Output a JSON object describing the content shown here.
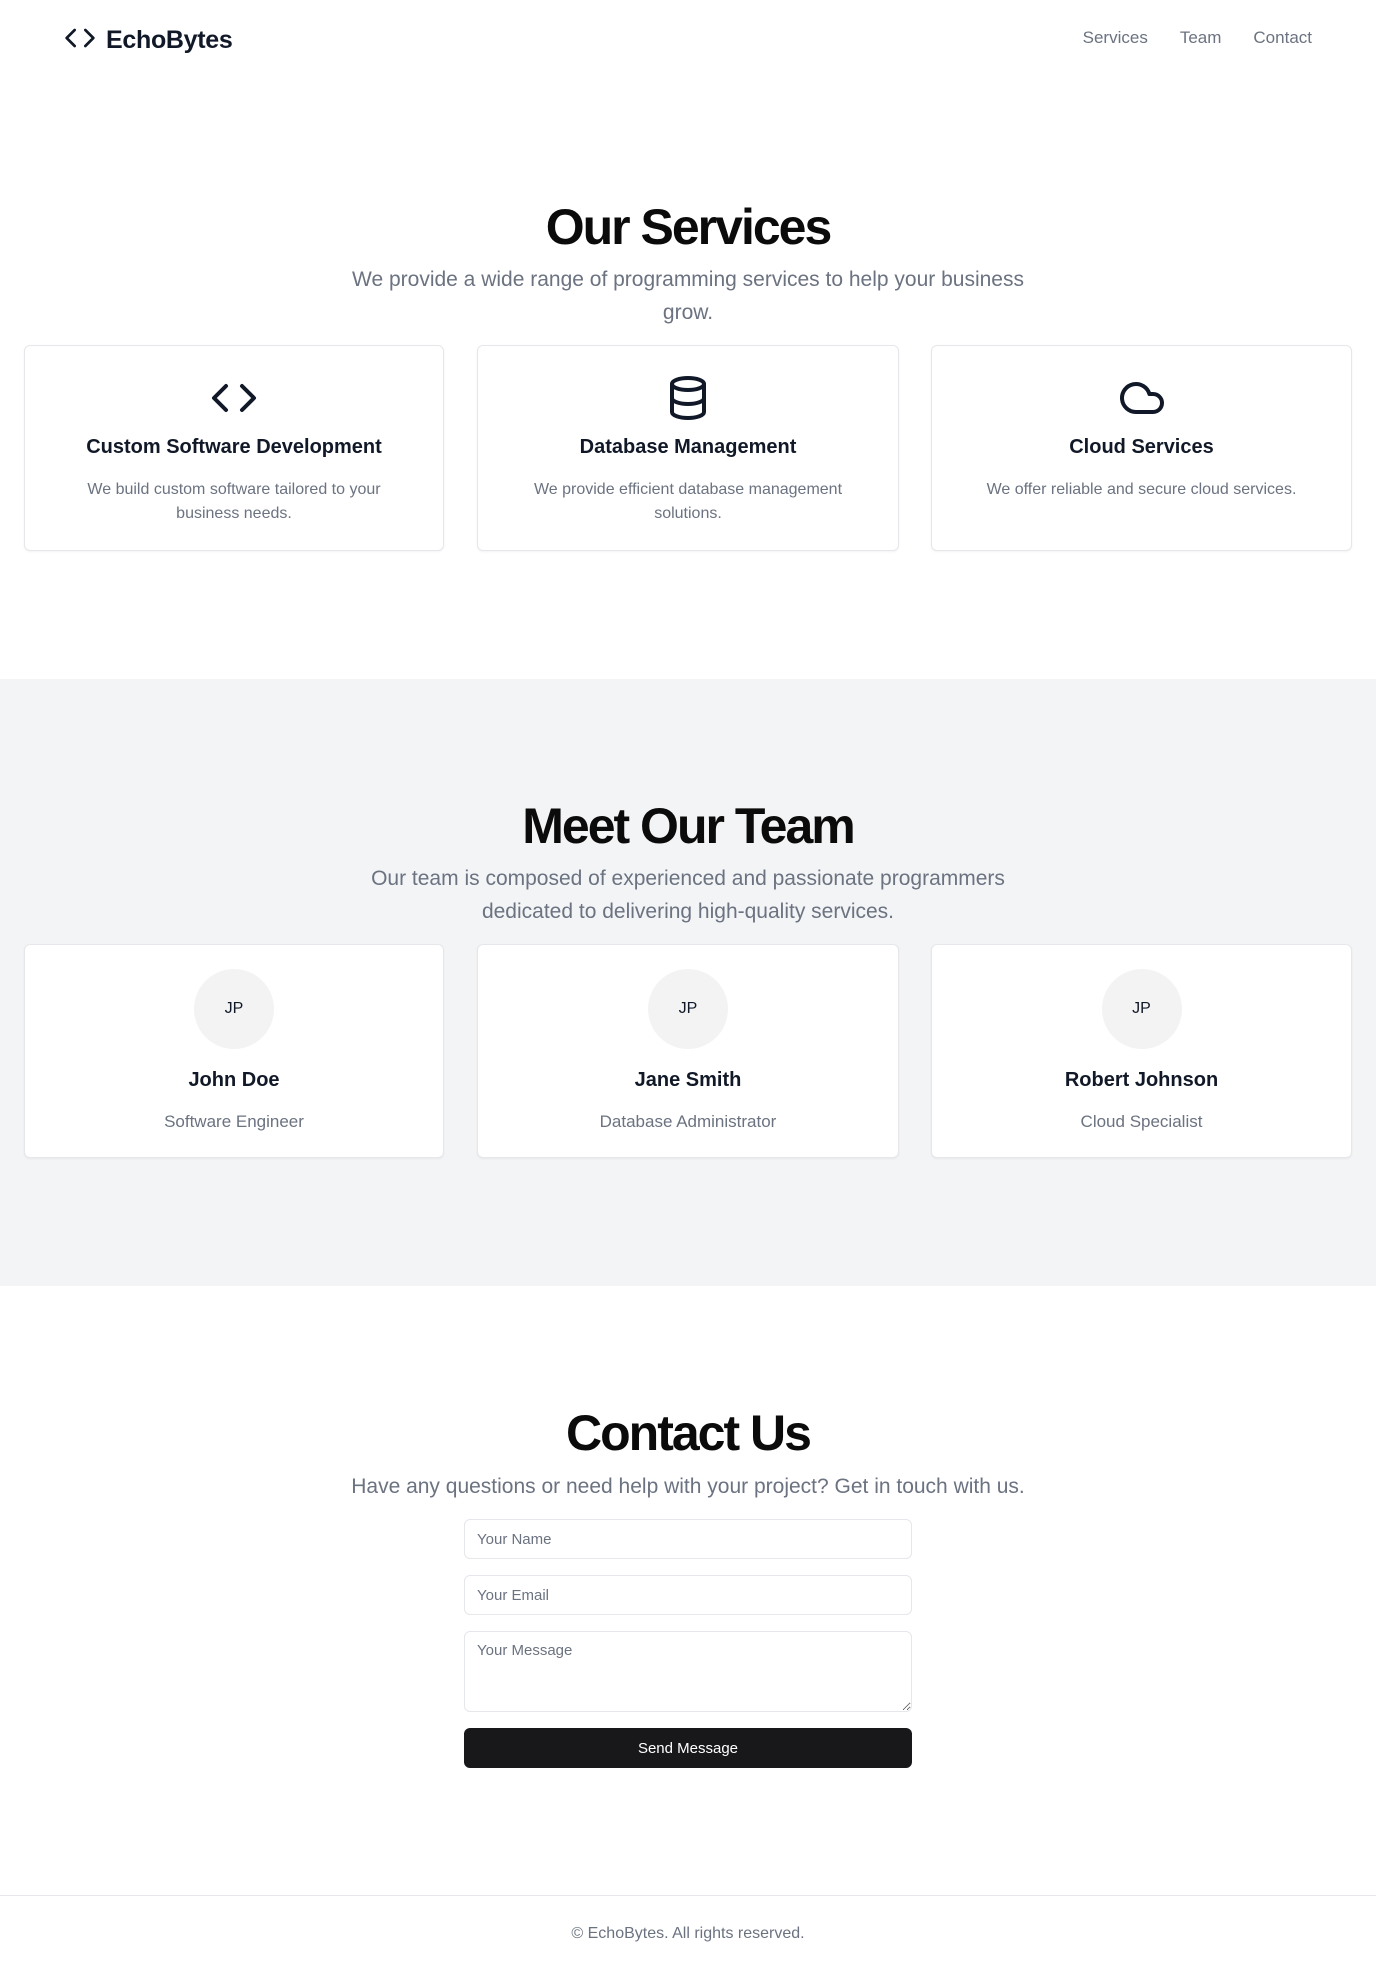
{
  "header": {
    "brand": "EchoBytes",
    "brand_icon": "code-icon",
    "nav": [
      "Services",
      "Team",
      "Contact"
    ]
  },
  "services": {
    "title": "Our Services",
    "subtitle": "We provide a wide range of programming services to help your business grow.",
    "items": [
      {
        "icon": "code-icon",
        "title": "Custom Software Development",
        "description": "We build custom software tailored to your business needs."
      },
      {
        "icon": "database-icon",
        "title": "Database Management",
        "description": "We provide efficient database management solutions."
      },
      {
        "icon": "cloud-icon",
        "title": "Cloud Services",
        "description": "We offer reliable and secure cloud services."
      }
    ]
  },
  "team": {
    "title": "Meet Our Team",
    "subtitle": "Our team is composed of experienced and passionate programmers dedicated to delivering high-quality services.",
    "members": [
      {
        "initials": "JP",
        "name": "John Doe",
        "role": "Software Engineer"
      },
      {
        "initials": "JP",
        "name": "Jane Smith",
        "role": "Database Administrator"
      },
      {
        "initials": "JP",
        "name": "Robert Johnson",
        "role": "Cloud Specialist"
      }
    ]
  },
  "contact": {
    "title": "Contact Us",
    "subtitle": "Have any questions or need help with your project? Get in touch with us.",
    "name_placeholder": "Your Name",
    "email_placeholder": "Your Email",
    "message_placeholder": "Your Message",
    "submit_label": "Send Message"
  },
  "footer": {
    "text": "© EchoBytes. All rights reserved."
  },
  "colors": {
    "primary_text": "#111827",
    "muted_text": "#6b7280",
    "section_alt_bg": "#f3f4f6",
    "button_bg": "#18181b"
  }
}
